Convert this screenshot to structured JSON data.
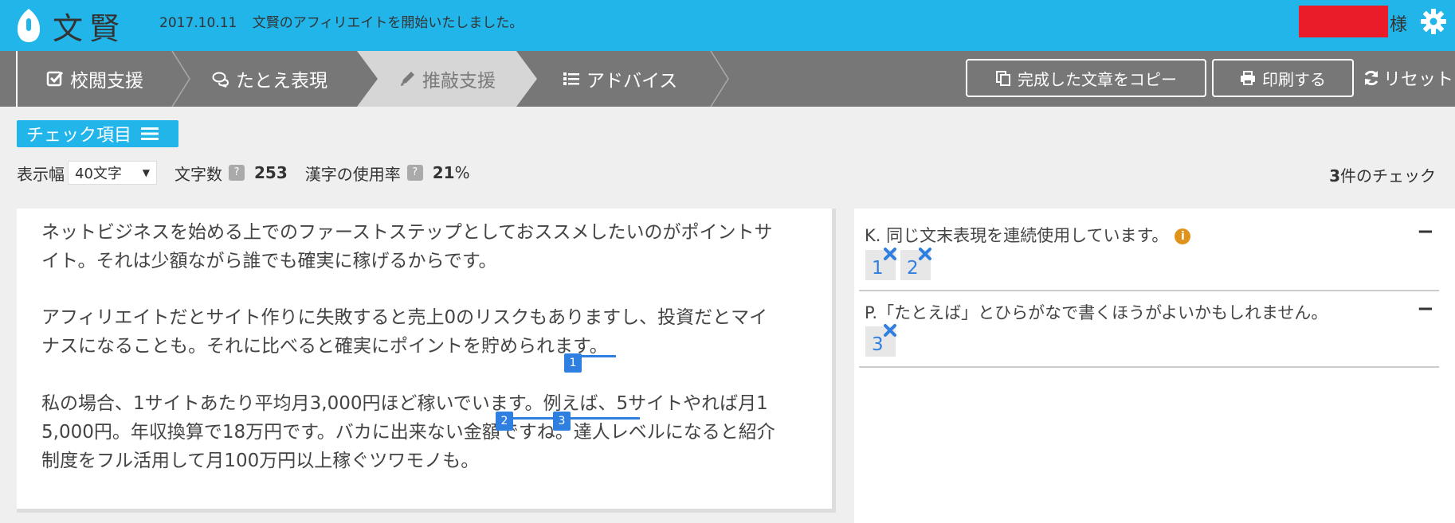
{
  "header": {
    "brand": "文賢",
    "news_date": "2017.10.11",
    "news_text": "文賢のアフィリエイトを開始いたしました。",
    "user_suffix": "様",
    "colors": {
      "bar": "#21b5ea",
      "redacted": "#ea1c2a"
    }
  },
  "nav": {
    "steps": [
      {
        "label": "校閲支援",
        "icon": "check-square-icon"
      },
      {
        "label": "たとえ表現",
        "icon": "chat-bubbles-icon"
      },
      {
        "label": "推敲支援",
        "icon": "pencil-icon"
      },
      {
        "label": "アドバイス",
        "icon": "list-icon"
      }
    ],
    "active_step": 2,
    "copy_button": "完成した文章をコピー",
    "print_button": "印刷する",
    "reset_button": "リセット"
  },
  "toolbar": {
    "check_items": "チェック項目",
    "width_label": "表示幅",
    "width_value": "40文字",
    "char_count_label": "文字数",
    "char_count_value": "253",
    "kanji_rate_label": "漢字の使用率",
    "kanji_rate_value": "21",
    "kanji_rate_unit": "%",
    "help_mark": "?",
    "check_count": "3",
    "check_count_suffix": "件のチェック"
  },
  "editor": {
    "lines": [
      "ネットビジネスを始める上でのファーストステップとしておススメしたいのがポイントサ",
      "イト。それは少額ながら誰でも確実に稼げるからです。",
      "アフィリエイトだとサイト作りに失敗すると売上0のリスクもありますし、投資だとマイ",
      "ナスになることも。それに比べると確実にポイントを貯められます。",
      "私の場合、1サイトあたり平均月3,000円ほど稼いでいます。例えば、5サイトやれば月1",
      "5,000円。年収換算で18万円です。バカに出来ない金額ですね。達人レベルになると紹介",
      "制度をフル活用して月100万円以上稼ぐツワモノも。"
    ],
    "markers": [
      "1",
      "2",
      "3"
    ]
  },
  "issues": [
    {
      "title": "K. 同じ文末表現を連続使用しています。",
      "chips": [
        "1",
        "2"
      ],
      "collapse": "−"
    },
    {
      "title": "P.「たとえば」とひらがなで書くほうがよいかもしれません。",
      "chips": [
        "3"
      ],
      "collapse": "−"
    }
  ]
}
